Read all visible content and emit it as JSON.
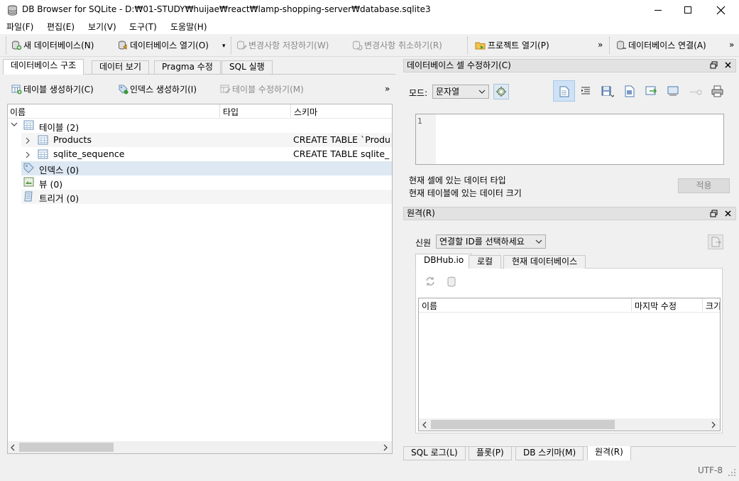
{
  "window": {
    "title": "DB Browser for SQLite - D:₩01-STUDY₩huijae₩react₩lamp-shopping-server₩database.sqlite3"
  },
  "menu": [
    "파일(F)",
    "편집(E)",
    "보기(V)",
    "도구(T)",
    "도움말(H)"
  ],
  "toolbar": {
    "new_db": "새 데이터베이스(N)",
    "open_db": "데이터베이스 열기(O)",
    "write_changes": "변경사항 저장하기(W)",
    "revert_changes": "변경사항 취소하기(R)",
    "open_project": "프로젝트 열기(P)",
    "attach_db": "데이터베이스 연결(A)",
    "overflow": "»"
  },
  "left_tabs": [
    "데이터베이스 구조",
    "데이터 보기",
    "Pragma 수정",
    "SQL 실행"
  ],
  "structure_toolbar": {
    "create_table": "테이블 생성하기(C)",
    "create_index": "인덱스 생성하기(I)",
    "modify_table": "테이블 수정하기(M)",
    "overflow": "»"
  },
  "tree": {
    "columns": [
      "이름",
      "타입",
      "스키마"
    ],
    "tables_label": "테이블 (2)",
    "tables": [
      {
        "name": "Products",
        "schema": "CREATE TABLE `Produ"
      },
      {
        "name": "sqlite_sequence",
        "schema": "CREATE TABLE sqlite_"
      }
    ],
    "indices_label": "인덱스 (0)",
    "views_label": "뷰 (0)",
    "triggers_label": "트리거 (0)"
  },
  "edit_cell": {
    "title": "데이터베이스 셀 수정하기(C)",
    "mode_label": "모드:",
    "mode_value": "문자열",
    "line_number": "1",
    "type_info": "현재 셀에 있는 데이터 타입",
    "size_info": "현재 테이블에 있는 데이터 크기",
    "apply_label": "적용"
  },
  "remote": {
    "title": "원격(R)",
    "identity_label": "신원",
    "identity_value": "연결할 ID를 선택하세요",
    "tabs": [
      "DBHub.io",
      "로컬",
      "현재 데이터베이스"
    ],
    "columns": [
      "이름",
      "마지막 수정",
      "크기"
    ]
  },
  "bottom_tabs": [
    "SQL 로그(L)",
    "플롯(P)",
    "DB 스키마(M)",
    "원격(R)"
  ],
  "status": {
    "encoding": "UTF-8"
  },
  "colors": {
    "selection": "#dde8f3",
    "accent": "#cfe2f5",
    "dock_title": "#e2e2e2"
  }
}
